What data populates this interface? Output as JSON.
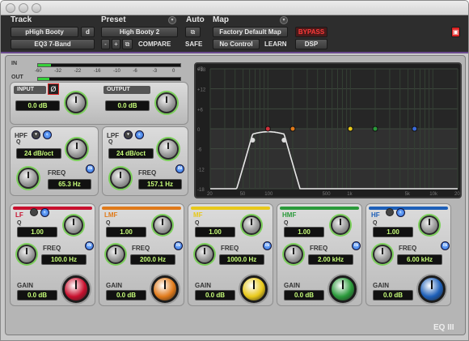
{
  "window": {
    "close": "close",
    "minimize": "minimize",
    "zoom": "zoom"
  },
  "header": {
    "track_label": "Track",
    "preset_label": "Preset",
    "auto_label": "Auto",
    "map_label": "Map",
    "track_name": "pHigh Booty",
    "track_chan": "d",
    "plugin_name": "EQ3 7-Band",
    "preset_name": "High Booty 2",
    "minus": "-",
    "plus": "+",
    "compare": "COMPARE",
    "safe": "SAFE",
    "map_name": "Factory Default Map",
    "no_control": "No Control",
    "learn": "LEARN",
    "bypass": "BYPASS",
    "dsp": "DSP"
  },
  "io": {
    "in": "IN",
    "out": "OUT",
    "scale": [
      "-60",
      "-32",
      "-22",
      "-16",
      "-10",
      "-6",
      "-3",
      "0"
    ],
    "input_label": "INPUT",
    "output_label": "OUTPUT",
    "input_value": "0.0 dB",
    "output_value": "0.0 dB",
    "phase": "Ø"
  },
  "hpf": {
    "label": "HPF",
    "q": "Q",
    "slope": "24 dB/oct",
    "freq_label": "FREQ",
    "freq": "65.3 Hz",
    "in": "IN"
  },
  "lpf": {
    "label": "LPF",
    "q": "Q",
    "slope": "24 dB/oct",
    "freq_label": "FREQ",
    "freq": "157.1 Hz",
    "in": "IN"
  },
  "graph": {
    "db_ticks": [
      "dB",
      "+18",
      "+12",
      "+6",
      "0",
      "-6",
      "-12",
      "-18"
    ],
    "freq_ticks": [
      "20",
      "50",
      "100",
      "500",
      "1k",
      "5k",
      "10k",
      "20k"
    ]
  },
  "bands": [
    {
      "label": "LF",
      "q": "1.00",
      "freq": "100.0 Hz",
      "gain": "0.0 dB",
      "color": "#c8102e",
      "shelf": true
    },
    {
      "label": "LMF",
      "q": "1.00",
      "freq": "200.0 Hz",
      "gain": "0.0 dB",
      "color": "#e07a1a",
      "shelf": false
    },
    {
      "label": "MF",
      "q": "1.00",
      "freq": "1000.0 Hz",
      "gain": "0.0 dB",
      "color": "#e8c81a",
      "shelf": false
    },
    {
      "label": "HMF",
      "q": "1.00",
      "freq": "2.00 kHz",
      "gain": "0.0 dB",
      "color": "#2a9a3a",
      "shelf": false
    },
    {
      "label": "HF",
      "q": "1.00",
      "freq": "6.00 kHz",
      "gain": "0.0 dB",
      "color": "#1d5fb8",
      "shelf": true
    }
  ],
  "band_labels": {
    "q": "Q",
    "freq": "FREQ",
    "gain": "GAIN",
    "in": "IN"
  },
  "brand": "EQ III"
}
